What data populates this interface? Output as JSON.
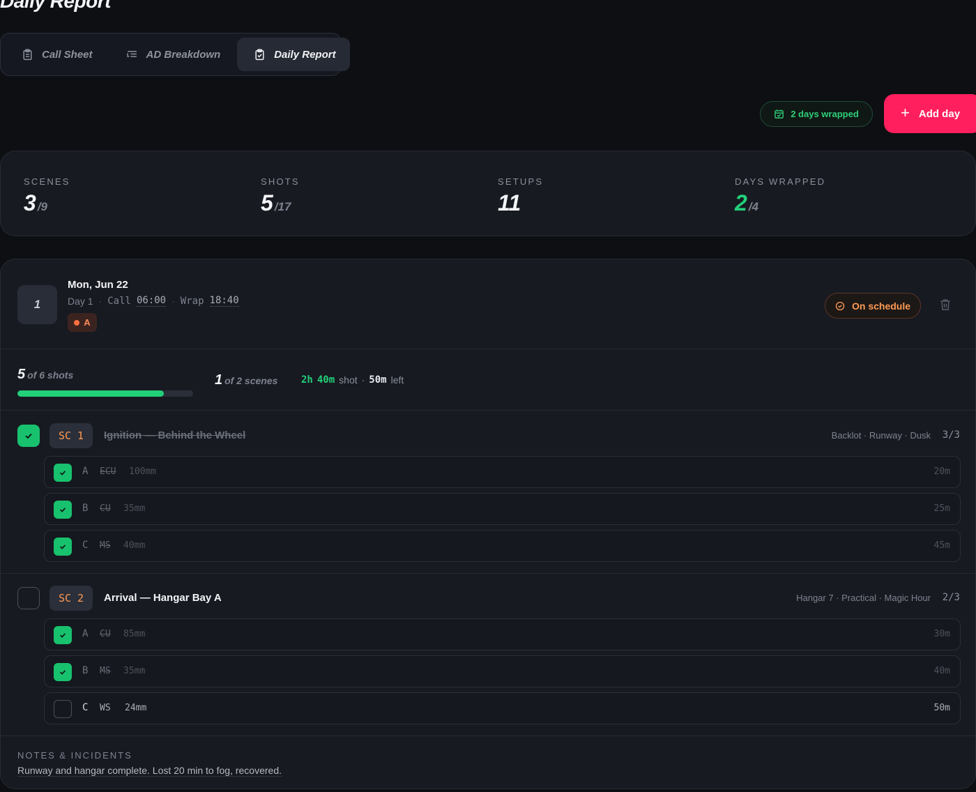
{
  "page": {
    "title": "Daily Report"
  },
  "tabs": [
    {
      "label": "Call Sheet",
      "icon": "clipboard-icon",
      "active": false
    },
    {
      "label": "AD Breakdown",
      "icon": "list-indent-icon",
      "active": false
    },
    {
      "label": "Daily Report",
      "icon": "clipboard-check-icon",
      "active": true
    }
  ],
  "header": {
    "wrapped_label": "2 days wrapped",
    "add_label": "Add day"
  },
  "stats": {
    "scenes": {
      "label": "SCENES",
      "value": "3",
      "of": "/9"
    },
    "shots": {
      "label": "SHOTS",
      "value": "5",
      "of": "/17"
    },
    "setups": {
      "label": "SETUPS",
      "value": "11"
    },
    "days_wrapped": {
      "label": "DAYS WRAPPED",
      "value": "2",
      "of": "/4"
    }
  },
  "day": {
    "number": "1",
    "date": "Mon, Jun 22",
    "day_label": "Day 1",
    "call_label": "Call",
    "call_time": "06:00",
    "wrap_label": "Wrap",
    "wrap_time": "18:40",
    "unit": "A",
    "status": "On schedule",
    "progress": {
      "shots_done": "5",
      "shots_text": "of 6 shots",
      "shots_fraction": 0.833,
      "scenes_done": "1",
      "scenes_text": "of 2 scenes",
      "shot_time_h": "2h",
      "shot_time_m": "40m",
      "shot_label": "shot",
      "left_time": "50m",
      "left_label": "left"
    },
    "scenes": [
      {
        "tag": "SC 1",
        "title": "Ignition — Behind the Wheel",
        "location": "Backlot · Runway · Dusk",
        "count": "3/3",
        "done": true,
        "shots": [
          {
            "letter": "A",
            "type": "ECU",
            "lens": "100mm",
            "duration": "20m",
            "done": true
          },
          {
            "letter": "B",
            "type": "CU",
            "lens": "35mm",
            "duration": "25m",
            "done": true
          },
          {
            "letter": "C",
            "type": "MS",
            "lens": "40mm",
            "duration": "45m",
            "done": true
          }
        ]
      },
      {
        "tag": "SC 2",
        "title": "Arrival — Hangar Bay A",
        "location": "Hangar 7 · Practical · Magic Hour",
        "count": "2/3",
        "done": false,
        "shots": [
          {
            "letter": "A",
            "type": "CU",
            "lens": "85mm",
            "duration": "30m",
            "done": true
          },
          {
            "letter": "B",
            "type": "MS",
            "lens": "35mm",
            "duration": "40m",
            "done": true
          },
          {
            "letter": "C",
            "type": "WS",
            "lens": "24mm",
            "duration": "50m",
            "done": false
          }
        ]
      }
    ],
    "notes_label": "NOTES & INCIDENTS",
    "notes": "Runway and hangar complete. Lost 20 min to fog, recovered."
  },
  "colors": {
    "accent": "#ff1f5e",
    "success": "#22d07a",
    "warning": "#ff9a55",
    "background": "#0d0f13",
    "card": "#171a21"
  }
}
